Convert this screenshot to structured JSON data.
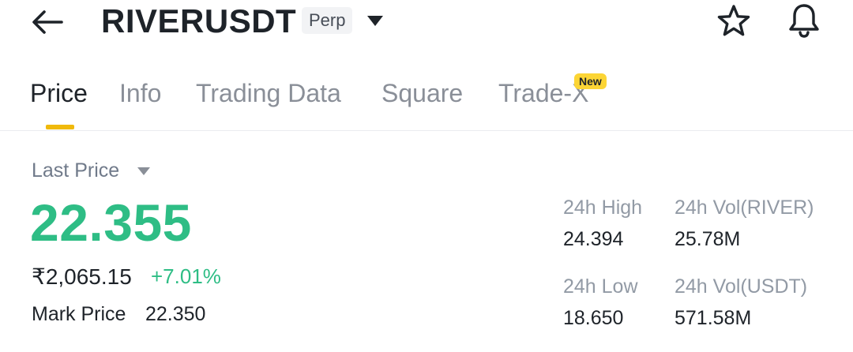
{
  "header": {
    "back_icon": "back-arrow-icon",
    "symbol": "RIVERUSDT",
    "contract_type": "Perp",
    "caret_icon": "caret-down-icon",
    "favorite_icon": "star-icon",
    "alerts_icon": "bell-icon"
  },
  "tabs": [
    {
      "label": "Price",
      "active": true
    },
    {
      "label": "Info",
      "active": false
    },
    {
      "label": "Trading Data",
      "active": false
    },
    {
      "label": "Square",
      "active": false
    },
    {
      "label": "Trade-X",
      "active": false,
      "badge": "New"
    }
  ],
  "price": {
    "last_price_label": "Last Price",
    "last_price": "22.355",
    "fiat_price": "₹2,065.15",
    "change_percent": "+7.01%",
    "mark_price_label": "Mark Price",
    "mark_price": "22.350"
  },
  "stats": {
    "high_label": "24h High",
    "high_value": "24.394",
    "low_label": "24h Low",
    "low_value": "18.650",
    "vol_base_label": "24h Vol(RIVER)",
    "vol_base_value": "25.78M",
    "vol_quote_label": "24h Vol(USDT)",
    "vol_quote_value": "571.58M"
  },
  "colors": {
    "accent": "#f0b90b",
    "up": "#2ebd85",
    "badge": "#fcd535"
  }
}
